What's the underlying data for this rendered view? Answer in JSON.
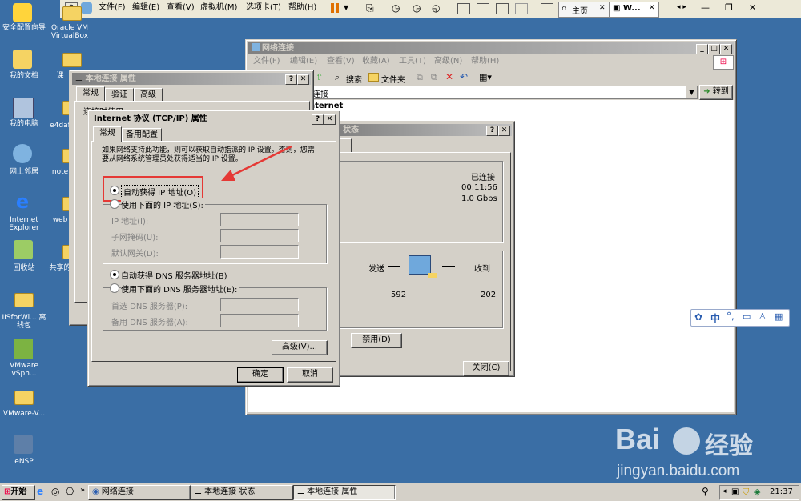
{
  "vm_toolbar": {
    "menus": [
      "文件(F)",
      "编辑(E)",
      "查看(V)",
      "虚拟机(M)",
      "选项卡(T)",
      "帮助(H)"
    ],
    "tabs": [
      "主页",
      "W..."
    ]
  },
  "desktop_icons": [
    "安全配置向导",
    "我的文档",
    "我的电脑",
    "网上邻居",
    "Internet Explorer",
    "回收站",
    "IISforWi... 离线包",
    "VMware vSph...",
    "VMware-V...",
    "eNSP"
  ],
  "desktop_icons_col2": [
    "Oracle VM VirtualBox",
    "课",
    "e4daf",
    "note",
    "web",
    "共享的"
  ],
  "network_window": {
    "title": "网络连接",
    "menus": [
      "文件(F)",
      "编辑(E)",
      "查看(V)",
      "收藏(A)",
      "工具(T)",
      "高级(N)",
      "帮助(H)"
    ],
    "search_label": "搜索",
    "folders_label": "文件夹",
    "address_value": "连接",
    "goto_label": "转到",
    "content_text": "nternet"
  },
  "status_window": {
    "title": "状态",
    "status_value": "已连接",
    "duration_value": "00:11:56",
    "speed_value": "1.0 Gbps",
    "sent_label": "发送",
    "received_label": "收到",
    "sent_value": "592",
    "received_value": "202",
    "disable_button": "禁用(D)",
    "close_button": "关闭(C)"
  },
  "props_window": {
    "title": "本地连接 属性",
    "tabs": [
      "常规",
      "验证",
      "高级"
    ],
    "connect_using": "连接时使用:"
  },
  "tcpip_dialog": {
    "title": "Internet 协议 (TCP/IP) 属性",
    "tabs": [
      "常规",
      "备用配置"
    ],
    "description": "如果网络支持此功能，则可以获取自动指派的 IP 设置。否则，您需要从网络系统管理员处获得适当的 IP 设置。",
    "auto_ip": "自动获得 IP 地址(O)",
    "manual_ip": "使用下面的 IP 地址(S):",
    "ip_label": "IP 地址(I):",
    "mask_label": "子网掩码(U):",
    "gateway_label": "默认网关(D):",
    "auto_dns": "自动获得 DNS 服务器地址(B)",
    "manual_dns": "使用下面的 DNS 服务器地址(E):",
    "dns1_label": "首选 DNS 服务器(P):",
    "dns2_label": "备用 DNS 服务器(A):",
    "advanced_button": "高级(V)...",
    "ok_button": "确定",
    "cancel_button": "取消"
  },
  "ime_bar": {
    "text": "中"
  },
  "taskbar": {
    "start": "开始",
    "tasks": [
      "网络连接",
      "本地连接 状态",
      "本地连接 属性"
    ],
    "clock": "21:37"
  },
  "watermark": {
    "brand": "Bai",
    "suffix": "经验",
    "url": "jingyan.baidu.com"
  },
  "colors": {
    "desktop": "#3a6ea5",
    "highlight_box": "#e53935",
    "title_active": "#0a246a"
  }
}
